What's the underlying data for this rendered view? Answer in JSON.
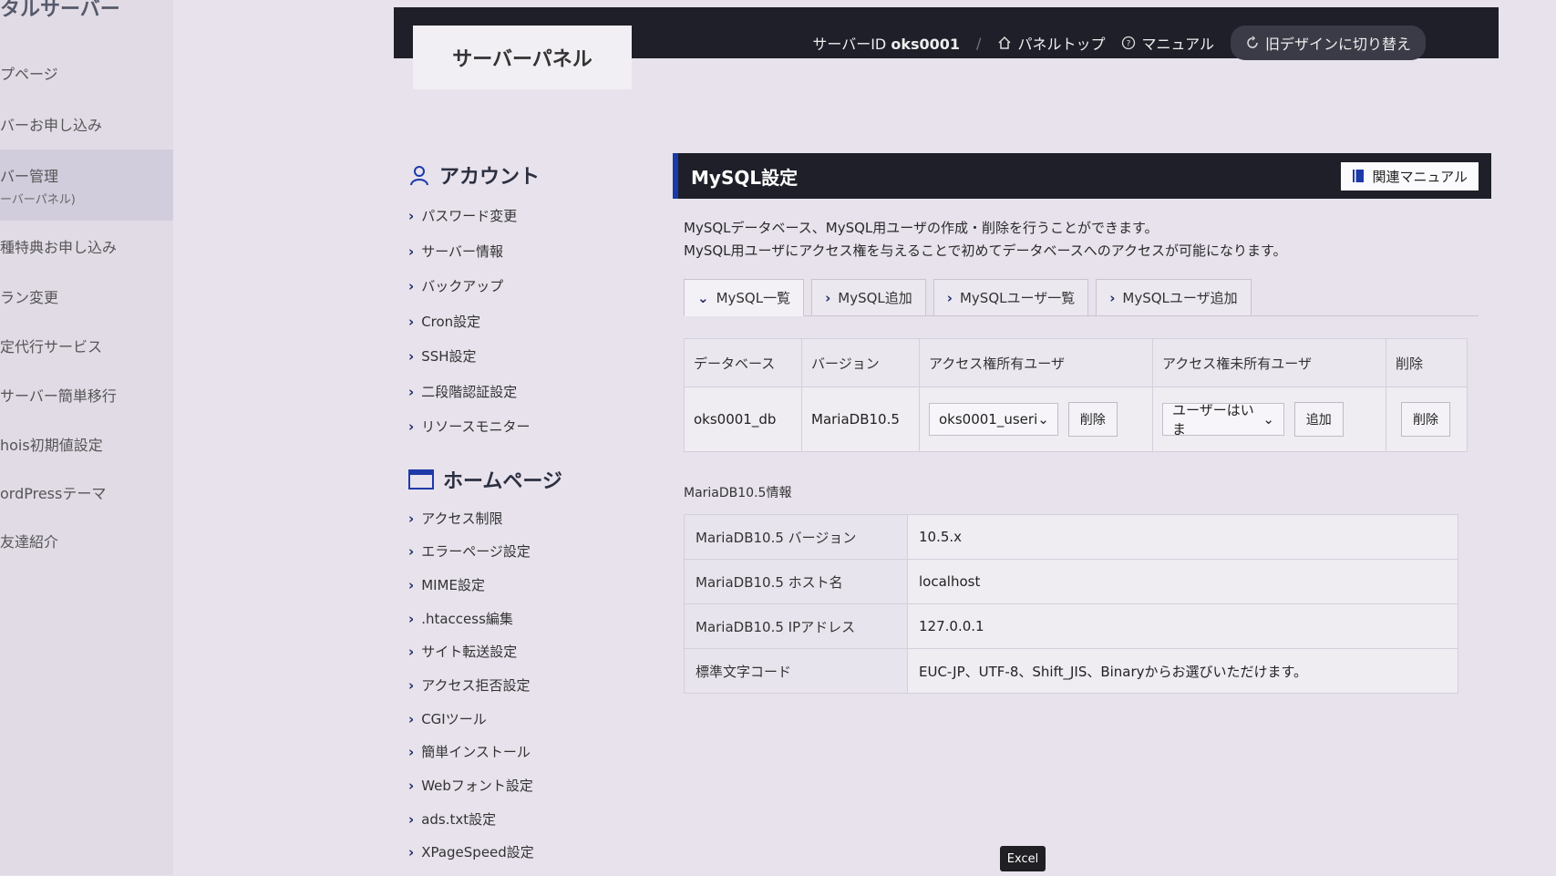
{
  "left_nav": {
    "brand": "タルサーバー",
    "items": [
      {
        "label": "プページ"
      },
      {
        "label": "バーお申し込み"
      },
      {
        "label": "バー管理",
        "sub": "ーバーパネル)"
      },
      {
        "label": "種特典お申し込み"
      },
      {
        "label": "ラン変更"
      },
      {
        "label": "定代行サービス"
      },
      {
        "label": "サーバー簡単移行"
      },
      {
        "label": "hois初期値設定"
      },
      {
        "label": "ordPressテーマ"
      },
      {
        "label": "友達紹介"
      }
    ]
  },
  "header": {
    "panel_tab": "サーバーパネル",
    "server_id_label": "サーバーID",
    "server_id": "oks0001",
    "separator": "/",
    "panel_top": "パネルトップ",
    "manual": "マニュアル",
    "old_design": "旧デザインに切り替え"
  },
  "sidebar": {
    "account_section": {
      "title": "アカウント",
      "items": [
        "パスワード変更",
        "サーバー情報",
        "バックアップ",
        "Cron設定",
        "SSH設定",
        "二段階認証設定",
        "リソースモニター"
      ]
    },
    "homepage_section": {
      "title": "ホームページ",
      "items": [
        "アクセス制限",
        "エラーページ設定",
        "MIME設定",
        ".htaccess編集",
        "サイト転送設定",
        "アクセス拒否設定",
        "CGIツール",
        "簡単インストール",
        "Webフォント設定",
        "ads.txt設定",
        "XPageSpeed設定"
      ]
    }
  },
  "main": {
    "title": "MySQL設定",
    "manual_button": "関連マニュアル",
    "desc_line1": "MySQLデータベース、MySQL用ユーザの作成・削除を行うことができます。",
    "desc_line2": "MySQL用ユーザにアクセス権を与えることで初めてデータベースへのアクセスが可能になります。",
    "tabs": [
      "MySQL一覧",
      "MySQL追加",
      "MySQLユーザ一覧",
      "MySQLユーザ追加"
    ],
    "table": {
      "headers": [
        "データベース",
        "バージョン",
        "アクセス権所有ユーザ",
        "アクセス権未所有ユーザ",
        "削除"
      ],
      "row": {
        "database": "oks0001_db",
        "version": "MariaDB10.5",
        "owner_user": "oks0001_useri",
        "owner_delete": "削除",
        "non_owner_user": "ユーザーはいま",
        "add": "追加",
        "delete": "削除"
      }
    },
    "info_title": "MariaDB10.5情報",
    "info": [
      {
        "key": "MariaDB10.5 バージョン",
        "value": "10.5.x"
      },
      {
        "key": "MariaDB10.5 ホスト名",
        "value": "localhost"
      },
      {
        "key": "MariaDB10.5 IPアドレス",
        "value": "127.0.0.1"
      },
      {
        "key": "標準文字コード",
        "value": "EUC-JP、UTF-8、Shift_JIS、Binaryからお選びいただけます。"
      }
    ]
  },
  "taskbar": {
    "excel": "Excel"
  }
}
